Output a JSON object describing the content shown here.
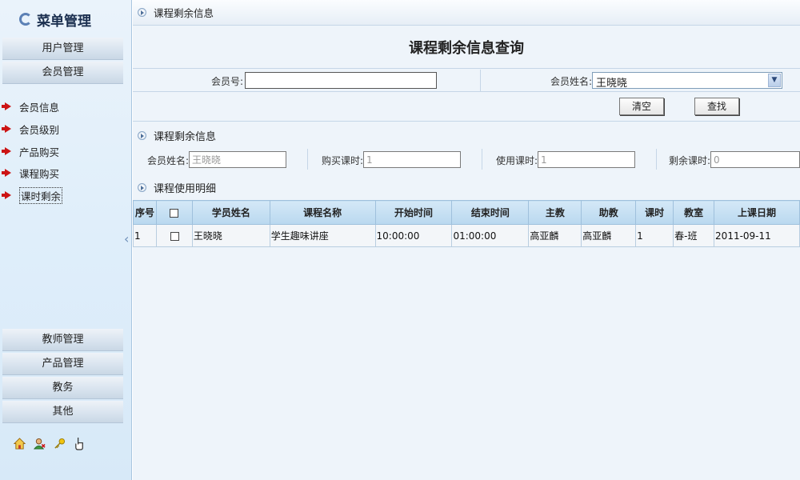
{
  "sidebar": {
    "title": "菜单管理",
    "groups_top": [
      {
        "label": "用户管理"
      },
      {
        "label": "会员管理"
      }
    ],
    "sub_items": [
      {
        "label": "会员信息"
      },
      {
        "label": "会员级别"
      },
      {
        "label": "产品购买"
      },
      {
        "label": "课程购买"
      },
      {
        "label": "课时剩余"
      }
    ],
    "groups_bottom": [
      {
        "label": "教师管理"
      },
      {
        "label": "产品管理"
      },
      {
        "label": "教务"
      },
      {
        "label": "其他"
      }
    ],
    "bottom_icons": [
      "home-icon",
      "user-icon",
      "key-icon",
      "hand-pointer-icon"
    ]
  },
  "breadcrumb": {
    "label": "课程剩余信息"
  },
  "page": {
    "title": "课程剩余信息查询"
  },
  "search": {
    "member_no_label": "会员号:",
    "member_no_value": "",
    "member_name_label": "会员姓名:",
    "member_name_value": "王晓晓",
    "clear_label": "清空",
    "search_label": "查找"
  },
  "remain": {
    "section_label": "课程剩余信息",
    "name_label": "会员姓名:",
    "name_value": "王晓晓",
    "bought_label": "购买课时:",
    "bought_value": "1",
    "used_label": "使用课时:",
    "used_value": "1",
    "left_label": "剩余课时:",
    "left_value": "0"
  },
  "detail": {
    "section_label": "课程使用明细",
    "columns": [
      "序号",
      "",
      "学员姓名",
      "课程名称",
      "开始时间",
      "结束时间",
      "主教",
      "助教",
      "课时",
      "教室",
      "上课日期"
    ],
    "rows": [
      [
        "1",
        "",
        "王晓晓",
        "学生趣味讲座",
        "10:00:00",
        "01:00:00",
        "高亚麟",
        "高亚麟",
        "1",
        "春-班",
        "2011-09-11"
      ]
    ]
  },
  "colors": {
    "sidebar_bg": "#dfeefa",
    "header_bg": "#b9d8ef",
    "accent_red": "#cc1414"
  }
}
